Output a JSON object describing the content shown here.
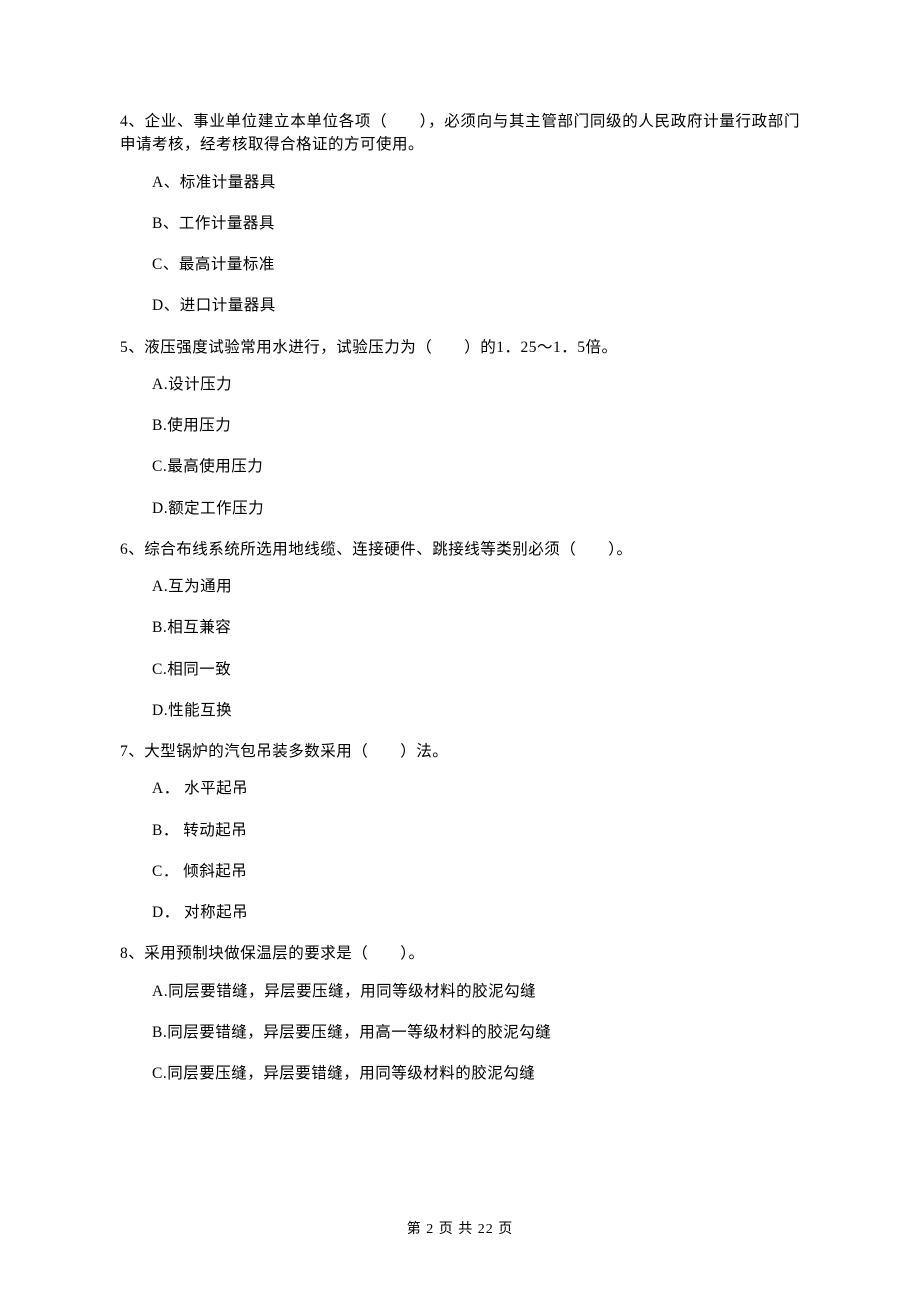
{
  "questions": [
    {
      "stem": "4、企业、事业单位建立本单位各项（　　），必须向与其主管部门同级的人民政府计量行政部门申请考核，经考核取得合格证的方可使用。",
      "options": [
        "A、标准计量器具",
        "B、工作计量器具",
        "C、最高计量标准",
        "D、进口计量器具"
      ]
    },
    {
      "stem": "5、液压强度试验常用水进行，试验压力为（　　）的1．25～1．5倍。",
      "options": [
        "A.设计压力",
        "B.使用压力",
        "C.最高使用压力",
        "D.额定工作压力"
      ]
    },
    {
      "stem": "6、综合布线系统所选用地线缆、连接硬件、跳接线等类别必须（　　）。",
      "options": [
        "A.互为通用",
        "B.相互兼容",
        "C.相同一致",
        "D.性能互换"
      ]
    },
    {
      "stem": "7、大型锅炉的汽包吊装多数采用（　　）法。",
      "options": [
        "A． 水平起吊",
        "B． 转动起吊",
        "C． 倾斜起吊",
        "D． 对称起吊"
      ]
    },
    {
      "stem": "8、采用预制块做保温层的要求是（　　）。",
      "options": [
        "A.同层要错缝，异层要压缝，用同等级材料的胶泥勾缝",
        "B.同层要错缝，异层要压缝，用高一等级材料的胶泥勾缝",
        "C.同层要压缝，异层要错缝，用同等级材料的胶泥勾缝"
      ]
    }
  ],
  "footer": "第 2 页 共 22 页"
}
